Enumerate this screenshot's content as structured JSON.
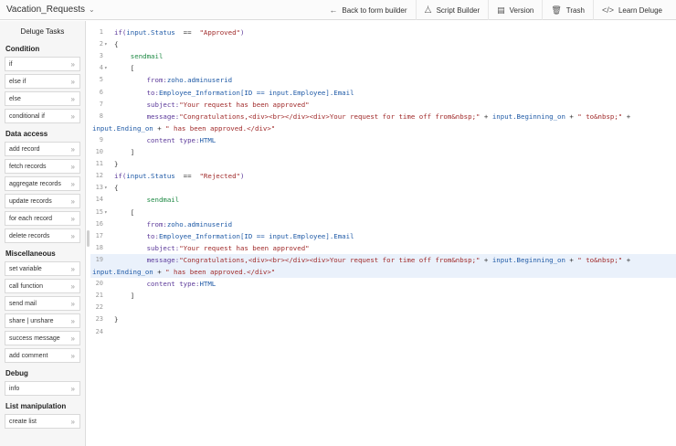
{
  "app": {
    "title": "Vacation_Requests"
  },
  "toolbar": {
    "back_label": "Back to form builder",
    "script_builder_label": "Script Builder",
    "version_label": "Version",
    "trash_label": "Trash",
    "learn_label": "Learn Deluge"
  },
  "sidebar": {
    "title": "Deluge Tasks",
    "sections": [
      {
        "title": "Condition",
        "items": [
          "if",
          "else if",
          "else",
          "conditional if"
        ]
      },
      {
        "title": "Data access",
        "items": [
          "add record",
          "fetch records",
          "aggregate records",
          "update records",
          "for each record",
          "delete records"
        ]
      },
      {
        "title": "Miscellaneous",
        "items": [
          "set variable",
          "call function",
          "send mail",
          "share | unshare",
          "success message",
          "add comment"
        ]
      },
      {
        "title": "Debug",
        "items": [
          "info"
        ]
      },
      {
        "title": "List manipulation",
        "items": [
          "create list"
        ]
      }
    ]
  },
  "editor": {
    "lines": [
      {
        "n": "1",
        "fold": "",
        "tokens": [
          [
            "kw",
            "if("
          ],
          [
            "vr",
            "input.Status"
          ],
          [
            "pl",
            "  ==  "
          ],
          [
            "str",
            "\"Approved\""
          ],
          [
            "kw",
            ")"
          ]
        ]
      },
      {
        "n": "2",
        "fold": "▾",
        "tokens": [
          [
            "pl",
            "{"
          ]
        ]
      },
      {
        "n": "3",
        "fold": "",
        "tokens": [
          [
            "fn",
            "    sendmail"
          ]
        ]
      },
      {
        "n": "4",
        "fold": "▾",
        "tokens": [
          [
            "pl",
            "    ["
          ]
        ]
      },
      {
        "n": "5",
        "fold": "",
        "tokens": [
          [
            "kw",
            "        from:"
          ],
          [
            "vr",
            "zoho.adminuserid"
          ]
        ]
      },
      {
        "n": "6",
        "fold": "",
        "tokens": [
          [
            "kw",
            "        to:"
          ],
          [
            "vr",
            "Employee_Information[ID == input.Employee].Email"
          ]
        ]
      },
      {
        "n": "7",
        "fold": "",
        "tokens": [
          [
            "kw",
            "        subject:"
          ],
          [
            "str",
            "\"Your request has been approved\""
          ]
        ]
      },
      {
        "n": "8",
        "fold": "",
        "tokens": [
          [
            "kw",
            "        message:"
          ],
          [
            "str",
            "\"Congratulations,<div><br></div><div>Your request for time off from&nbsp;\""
          ],
          [
            "pl",
            " + "
          ],
          [
            "vr",
            "input.Beginning_on"
          ],
          [
            "pl",
            " + "
          ],
          [
            "str",
            "\" to&nbsp;\""
          ],
          [
            "pl",
            " +"
          ]
        ]
      },
      {
        "n": "",
        "fold": "",
        "tokens": [
          [
            "vr",
            "input.Ending_on"
          ],
          [
            "pl",
            " + "
          ],
          [
            "str",
            "\" has been approved.</div>\""
          ]
        ]
      },
      {
        "n": "9",
        "fold": "",
        "tokens": [
          [
            "kw",
            "        content type:"
          ],
          [
            "vr",
            "HTML"
          ]
        ]
      },
      {
        "n": "10",
        "fold": "",
        "tokens": [
          [
            "pl",
            "    ]"
          ]
        ]
      },
      {
        "n": "11",
        "fold": "",
        "tokens": [
          [
            "pl",
            "}"
          ]
        ]
      },
      {
        "n": "12",
        "fold": "",
        "tokens": [
          [
            "kw",
            "if("
          ],
          [
            "vr",
            "input.Status"
          ],
          [
            "pl",
            "  ==  "
          ],
          [
            "str",
            "\"Rejected\""
          ],
          [
            "kw",
            ")"
          ]
        ]
      },
      {
        "n": "13",
        "fold": "▾",
        "tokens": [
          [
            "pl",
            "{"
          ]
        ]
      },
      {
        "n": "14",
        "fold": "",
        "tokens": [
          [
            "fn",
            "        sendmail"
          ]
        ]
      },
      {
        "n": "15",
        "fold": "▾",
        "tokens": [
          [
            "pl",
            "    ["
          ]
        ]
      },
      {
        "n": "16",
        "fold": "",
        "tokens": [
          [
            "kw",
            "        from:"
          ],
          [
            "vr",
            "zoho.adminuserid"
          ]
        ]
      },
      {
        "n": "17",
        "fold": "",
        "tokens": [
          [
            "kw",
            "        to:"
          ],
          [
            "vr",
            "Employee_Information[ID == input.Employee].Email"
          ]
        ]
      },
      {
        "n": "18",
        "fold": "",
        "tokens": [
          [
            "kw",
            "        subject:"
          ],
          [
            "str",
            "\"Your request has been approved\""
          ]
        ]
      },
      {
        "n": "19",
        "fold": "",
        "hl": true,
        "tokens": [
          [
            "kw",
            "        message:"
          ],
          [
            "str",
            "\"Congratulations,<div><br></div><div>Your request for time off from&nbsp;\""
          ],
          [
            "pl",
            " + "
          ],
          [
            "vr",
            "input.Beginning_on"
          ],
          [
            "pl",
            " + "
          ],
          [
            "str",
            "\" to&nbsp;\""
          ],
          [
            "pl",
            " +"
          ]
        ]
      },
      {
        "n": "",
        "fold": "",
        "hl": true,
        "tokens": [
          [
            "vr",
            "input.Ending_on"
          ],
          [
            "pl",
            " + "
          ],
          [
            "str",
            "\" has been approved.</div>\""
          ]
        ]
      },
      {
        "n": "20",
        "fold": "",
        "tokens": [
          [
            "kw",
            "        content type:"
          ],
          [
            "vr",
            "HTML"
          ]
        ]
      },
      {
        "n": "21",
        "fold": "",
        "tokens": [
          [
            "pl",
            "    ]"
          ]
        ]
      },
      {
        "n": "22",
        "fold": "",
        "tokens": []
      },
      {
        "n": "23",
        "fold": "",
        "tokens": [
          [
            "pl",
            "}"
          ]
        ]
      },
      {
        "n": "24",
        "fold": "",
        "tokens": []
      }
    ]
  },
  "icons": {
    "back": "arrow-left-icon",
    "script_builder": "script-builder-icon",
    "version": "version-icon",
    "trash": "trash-icon",
    "learn": "code-icon"
  }
}
